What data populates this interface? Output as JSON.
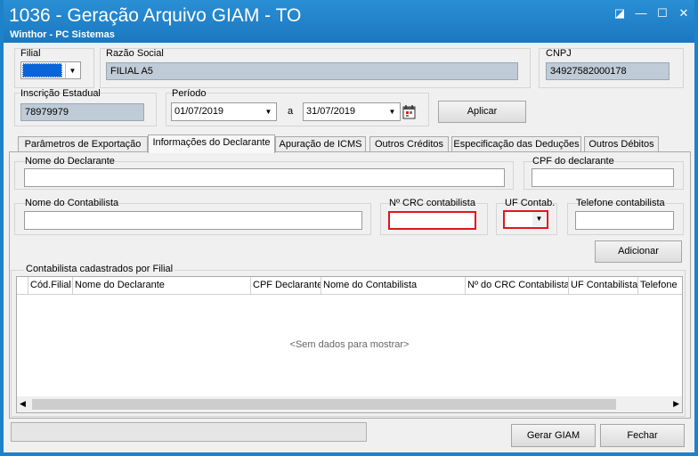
{
  "window": {
    "title": "1036 - Geração Arquivo GIAM - TO",
    "subtitle": "Winthor - PC Sistemas",
    "controls": [
      "◪",
      "—",
      "☐",
      "✕"
    ]
  },
  "header": {
    "filial_label": "Filial",
    "razao_label": "Razão Social",
    "razao_value": "FILIAL A5",
    "cnpj_label": "CNPJ",
    "cnpj_value": "34927582000178",
    "ie_label": "Inscrição Estadual",
    "ie_value": "78979979",
    "periodo_label": "Período",
    "date_from": "01/07/2019",
    "date_sep": "a",
    "date_to": "31/07/2019",
    "aplicar": "Aplicar"
  },
  "tabs": [
    {
      "label": "Parâmetros de Exportação"
    },
    {
      "label": "Informações do Declarante"
    },
    {
      "label": "Apuração de ICMS"
    },
    {
      "label": "Outros Créditos"
    },
    {
      "label": "Especificação das Deduções"
    },
    {
      "label": "Outros Débitos"
    }
  ],
  "form": {
    "nome_declarante": "Nome do Declarante",
    "cpf_declarante": "CPF do declarante",
    "nome_contabilista": "Nome do Contabilista",
    "crc": "Nº CRC contabilista",
    "uf": "UF Contab.",
    "telefone": "Telefone contabilista",
    "adicionar": "Adicionar"
  },
  "grid": {
    "group_label": "Contabilista cadastrados por Filial",
    "columns": [
      "Cód.Filial",
      "Nome do Declarante",
      "CPF Declarante",
      "Nome do Contabilista",
      "Nº do CRC Contabilista",
      "UF Contabilista",
      "Telefone"
    ],
    "empty": "<Sem dados para mostrar>"
  },
  "footer": {
    "gerar": "Gerar GIAM",
    "fechar": "Fechar"
  },
  "colors": {
    "title_bar": "#1b78c0",
    "readonly_field": "#bfcbd6",
    "required_border": "#e0161b"
  }
}
